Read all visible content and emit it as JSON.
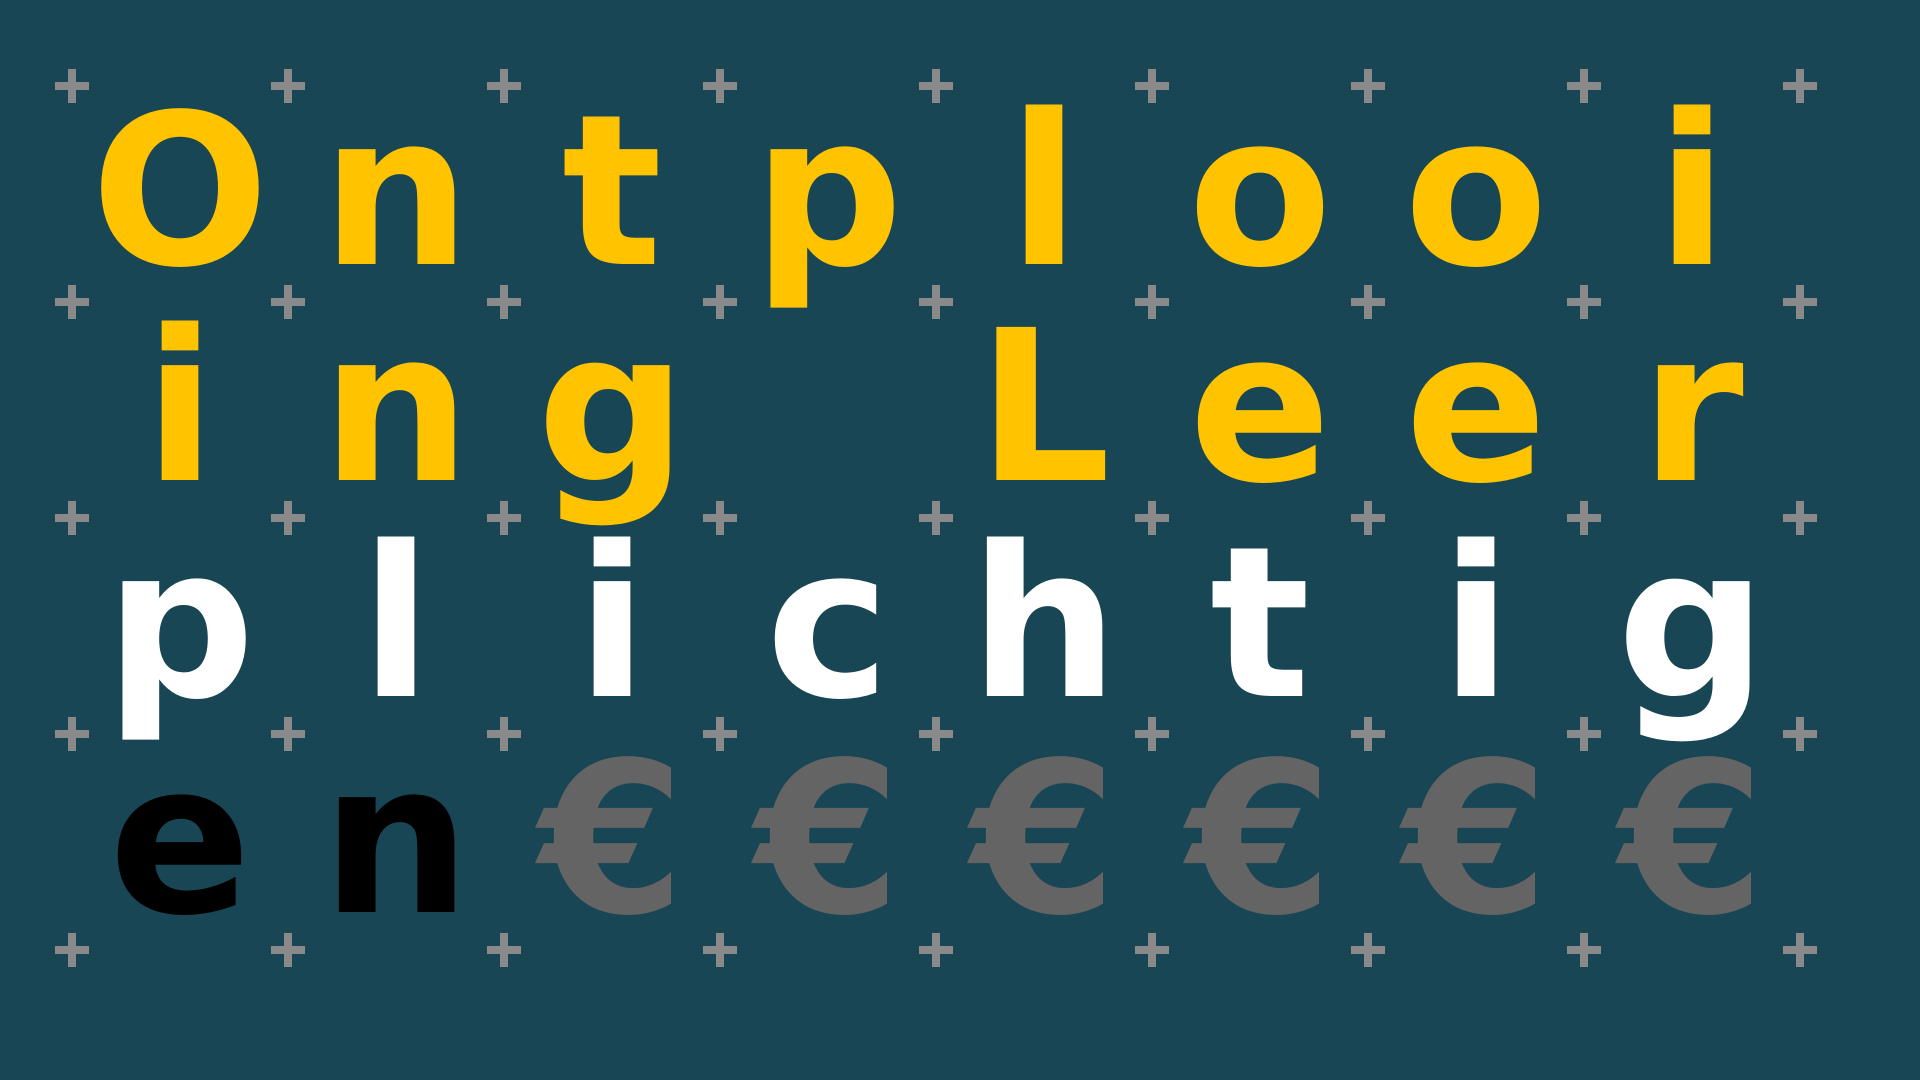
{
  "rows": [
    {
      "text": "Ontplooi",
      "color": "#ffc300"
    },
    {
      "text": "ing Leer",
      "color": "#ffc300"
    },
    {
      "text": "plichtig",
      "color": "#ffffff"
    },
    {
      "text": "en€€€€€€",
      "colors": [
        "#000000",
        "#000000",
        "#646464",
        "#646464",
        "#646464",
        "#646464",
        "#646464",
        "#646464"
      ]
    }
  ],
  "background_color": "#184654",
  "plus_color": "#8a8a8a"
}
